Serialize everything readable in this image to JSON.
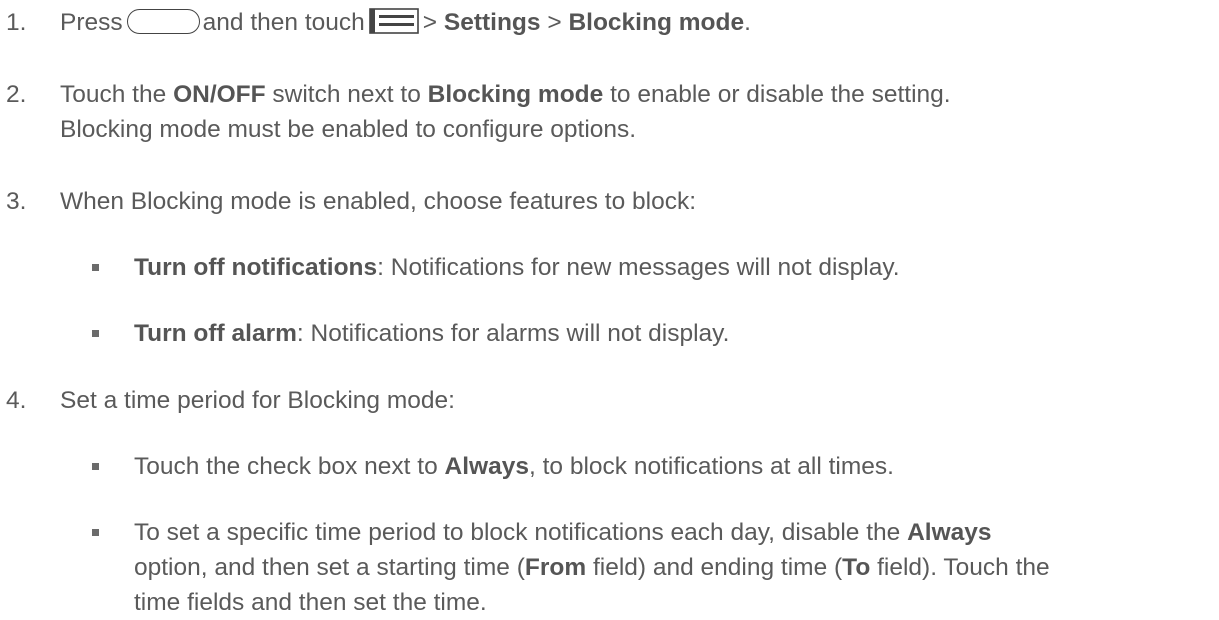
{
  "steps": [
    {
      "number": "1.",
      "parts": {
        "a": "Press",
        "b": "and then touch",
        "c": ">",
        "d": "Settings",
        "e": ">",
        "f": "Blocking mode",
        "g": "."
      }
    },
    {
      "number": "2.",
      "line1": {
        "a": "Touch the",
        "b": "ON/OFF",
        "c": "switch next to",
        "d": "Blocking mode",
        "e": "to enable or disable the setting."
      },
      "line2": "Blocking mode must be enabled to configure options."
    },
    {
      "number": "3.",
      "text": "When Blocking mode is enabled, choose features to block:",
      "bullets": [
        {
          "bold": "Turn off notifications",
          "rest": ": Notifications for new messages will not display."
        },
        {
          "bold": "Turn off alarm",
          "rest": ": Notifications for alarms will not display."
        }
      ]
    },
    {
      "number": "4.",
      "text": "Set a time period for Blocking mode:",
      "bullet1": {
        "a": "Touch the check box next to",
        "b": "Always",
        "c": ", to block notifications at all times."
      },
      "bullet2": {
        "line1a": "To set a specific time period to block notifications each day, disable the",
        "line1b": "Always",
        "line2a": "option, and then set a starting time (",
        "line2b": "From",
        "line2c": "field) and ending time (",
        "line2d": "To",
        "line2e": "field). Touch the",
        "line3": "time fields and then set the time."
      }
    }
  ],
  "icons": {
    "home": "home-button-icon",
    "menu": "menu-icon"
  }
}
